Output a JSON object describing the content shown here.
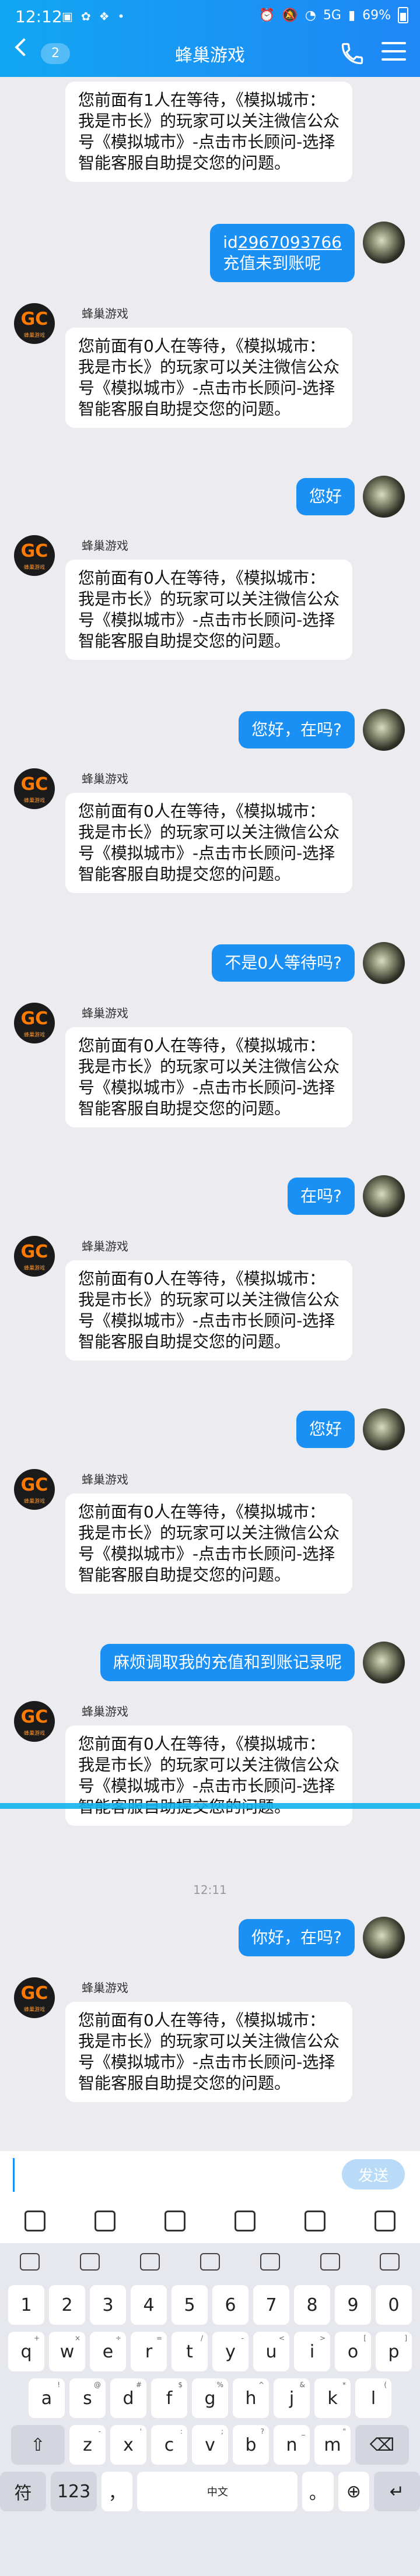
{
  "status_bar": {
    "time": "12:12",
    "battery": "69%",
    "signal": "5G"
  },
  "header": {
    "title": "蜂巢游戏",
    "unread": "2"
  },
  "bot": {
    "name": "蜂巢游戏",
    "avatar_text": "GC",
    "avatar_sub": "蜂巢游戏"
  },
  "messages": [
    {
      "type": "in",
      "text": "您前面有1人在等待，《模拟城市：我是市长》的玩家可以关注微信公众号《模拟城市》-点击市长顾问-选择智能客服自助提交您的问题。"
    },
    {
      "type": "out",
      "line1_prefix": "id",
      "line1_link": "2967093766",
      "line2": "充值未到账呢"
    },
    {
      "type": "in",
      "text": "您前面有0人在等待，《模拟城市：我是市长》的玩家可以关注微信公众号《模拟城市》-点击市长顾问-选择智能客服自助提交您的问题。"
    },
    {
      "type": "out",
      "text": "您好"
    },
    {
      "type": "in",
      "text": "您前面有0人在等待，《模拟城市：我是市长》的玩家可以关注微信公众号《模拟城市》-点击市长顾问-选择智能客服自助提交您的问题。"
    },
    {
      "type": "out",
      "text": "您好，在吗?"
    },
    {
      "type": "in",
      "text": "您前面有0人在等待，《模拟城市：我是市长》的玩家可以关注微信公众号《模拟城市》-点击市长顾问-选择智能客服自助提交您的问题。"
    },
    {
      "type": "out",
      "text": "不是0人等待吗?"
    },
    {
      "type": "in",
      "text": "您前面有0人在等待，《模拟城市：我是市长》的玩家可以关注微信公众号《模拟城市》-点击市长顾问-选择智能客服自助提交您的问题。"
    },
    {
      "type": "out",
      "text": "在吗?"
    },
    {
      "type": "in",
      "text": "您前面有0人在等待，《模拟城市：我是市长》的玩家可以关注微信公众号《模拟城市》-点击市长顾问-选择智能客服自助提交您的问题。"
    },
    {
      "type": "out",
      "text": "您好"
    },
    {
      "type": "in",
      "text": "您前面有0人在等待，《模拟城市：我是市长》的玩家可以关注微信公众号《模拟城市》-点击市长顾问-选择智能客服自助提交您的问题。"
    },
    {
      "type": "out",
      "text": "麻烦调取我的充值和到账记录呢"
    },
    {
      "type": "in",
      "text": "您前面有0人在等待，《模拟城市：我是市长》的玩家可以关注微信公众号《模拟城市》-点击市长顾问-选择智能客服自助提交您的问题。"
    },
    {
      "type": "time",
      "text": "12:11"
    },
    {
      "type": "out",
      "text": "你好，在吗?"
    },
    {
      "type": "in",
      "text": "您前面有0人在等待，《模拟城市：我是市长》的玩家可以关注微信公众号《模拟城市》-点击市长顾问-选择智能客服自助提交您的问题。"
    }
  ],
  "input": {
    "value": "",
    "send_label": "发送"
  },
  "toolbar_icons": [
    "mic-icon",
    "image-icon",
    "camera-icon",
    "gift-icon",
    "emoji-icon",
    "plus-icon"
  ],
  "keyboard": {
    "top_icons": [
      "emoji-icon",
      "keyboard-icon",
      "handwriting-icon",
      "clipboard-icon",
      "translate-icon",
      "settings-icon",
      "more-icon"
    ],
    "numbers": [
      "1",
      "2",
      "3",
      "4",
      "5",
      "6",
      "7",
      "8",
      "9",
      "0"
    ],
    "row1": [
      "q",
      "w",
      "e",
      "r",
      "t",
      "y",
      "u",
      "i",
      "o",
      "p"
    ],
    "row1_sub": [
      "+",
      "×",
      "÷",
      "=",
      "/",
      "-",
      "<",
      ">",
      "[",
      "]"
    ],
    "row2": [
      "a",
      "s",
      "d",
      "f",
      "g",
      "h",
      "j",
      "k",
      "l"
    ],
    "row2_sub": [
      "!",
      "@",
      "#",
      "$",
      "%",
      "^",
      "&",
      "*",
      "("
    ],
    "row3": [
      "z",
      "x",
      "c",
      "v",
      "b",
      "n",
      "m"
    ],
    "row3_sub": [
      "-",
      "'",
      ":",
      ";",
      "?",
      "_",
      "\""
    ],
    "bottom": {
      "symbols": "符",
      "num": "123",
      "comma": "，",
      "space": "中文",
      "period": "。"
    }
  }
}
